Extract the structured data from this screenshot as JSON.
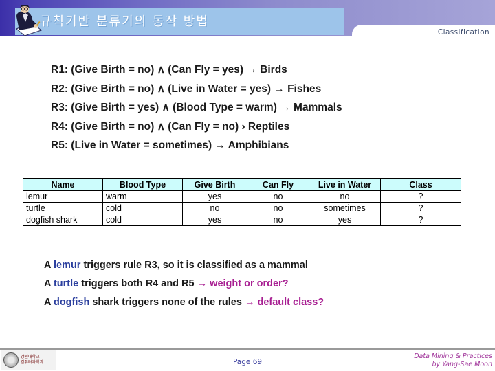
{
  "header": {
    "title": "규칙기반 분류기의 동작 방법",
    "section_label": "Classification",
    "clipart_name": "person-writing-clipart",
    "band_color_left": "#3b2fa8",
    "band_color_right": "#a6a4d8",
    "title_bar_color": "#9dc4ea",
    "title_text_color": "#ffffff",
    "section_label_color": "#3a4a6b"
  },
  "rules": [
    {
      "id": "R1",
      "text": "R1: (Give Birth = no) ∧ (Can Fly = yes) → Birds"
    },
    {
      "id": "R2",
      "text": "R2: (Give Birth = no) ∧ (Live in Water = yes) → Fishes"
    },
    {
      "id": "R3",
      "text": "R3: (Give Birth = yes) ∧ (Blood Type = warm) → Mammals"
    },
    {
      "id": "R4",
      "text": "R4: (Give Birth = no) ∧ (Can Fly = no)  › Reptiles"
    },
    {
      "id": "R5",
      "text": "R5: (Live in Water = sometimes) → Amphibians"
    }
  ],
  "table": {
    "header_bg": "#ccfcfc",
    "columns": [
      "Name",
      "Blood Type",
      "Give Birth",
      "Can Fly",
      "Live in Water",
      "Class"
    ],
    "rows": [
      {
        "name": "lemur",
        "blood_type": "warm",
        "give_birth": "yes",
        "can_fly": "no",
        "live_in_water": "no",
        "class": "?"
      },
      {
        "name": "turtle",
        "blood_type": "cold",
        "give_birth": "no",
        "can_fly": "no",
        "live_in_water": "sometimes",
        "class": "?"
      },
      {
        "name": "dogfish shark",
        "blood_type": "cold",
        "give_birth": "yes",
        "can_fly": "no",
        "live_in_water": "yes",
        "class": "?"
      }
    ]
  },
  "conclusions": [
    {
      "p1": "A ",
      "subject": "lemur",
      "p2": " triggers rule R3, so it is classified as a mammal",
      "result": ""
    },
    {
      "p1": "A ",
      "subject": "turtle",
      "p2": " triggers both R4 and R5 ",
      "result": "→ weight or order?"
    },
    {
      "p1": "A ",
      "subject": "dogfish",
      "p2": " shark triggers none of the rules ",
      "result": "→ default class?"
    }
  ],
  "colors": {
    "highlight_blue": "#2b3f9e",
    "highlight_magenta": "#a81f92",
    "footer_page_blue": "#3b3f9e",
    "footer_credit_purple": "#a0349a"
  },
  "footer": {
    "logo_line1": "강원대학교",
    "logo_line2": "컴퓨터과학과",
    "page": "Page 69",
    "credit_line1": "Data Mining & Practices",
    "credit_line2": "by Yang-Sae Moon"
  }
}
